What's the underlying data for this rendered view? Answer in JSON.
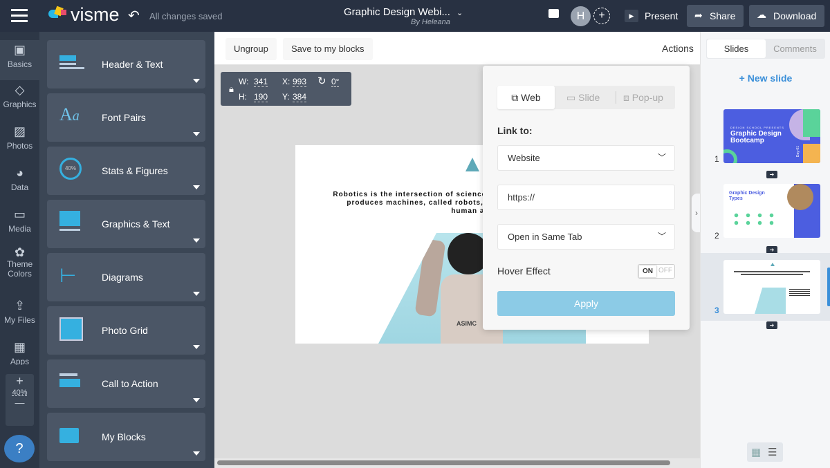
{
  "topbar": {
    "brand": "visme",
    "save_status": "All changes saved",
    "doc_title": "Graphic Design Webi...",
    "doc_author": "By Heleana",
    "avatar_initial": "H",
    "present": "Present",
    "share": "Share",
    "download": "Download"
  },
  "rail": [
    {
      "label": "Basics",
      "icon": "abc-blocks-icon"
    },
    {
      "label": "Graphics",
      "icon": "shapes-icon"
    },
    {
      "label": "Photos",
      "icon": "photo-icon"
    },
    {
      "label": "Data",
      "icon": "pie-chart-icon"
    },
    {
      "label": "Media",
      "icon": "media-icon"
    },
    {
      "label": "Theme Colors",
      "icon": "palette-icon"
    },
    {
      "label": "My Files",
      "icon": "upload-icon"
    },
    {
      "label": "Apps",
      "icon": "apps-grid-icon"
    }
  ],
  "zoom": {
    "plus": "+",
    "value": "40%",
    "minus": "—"
  },
  "help": "?",
  "blocks": [
    {
      "label": "Header & Text"
    },
    {
      "label": "Font Pairs"
    },
    {
      "label": "Stats & Figures",
      "badge": "40%"
    },
    {
      "label": "Graphics & Text"
    },
    {
      "label": "Diagrams"
    },
    {
      "label": "Photo Grid"
    },
    {
      "label": "Call to Action"
    },
    {
      "label": "My Blocks"
    }
  ],
  "toolbar": {
    "ungroup": "Ungroup",
    "save_blocks": "Save to my blocks",
    "actions": "Actions"
  },
  "dims": {
    "w_label": "W:",
    "w": "341",
    "h_label": "H:",
    "h": "190",
    "x_label": "X:",
    "x": "993",
    "y_label": "Y:",
    "y": "384",
    "rotation": "0°"
  },
  "slide": {
    "text1": "Robotics is the intersection of science,",
    "text2": "produces machines, called robots, t",
    "text3": "human ac",
    "robot_label": "ASIMC"
  },
  "popup": {
    "tabs": [
      {
        "label": "Web"
      },
      {
        "label": "Slide"
      },
      {
        "label": "Pop-up"
      }
    ],
    "link_to": "Link to:",
    "link_type": "Website",
    "url_placeholder": "https://",
    "open_mode": "Open in Same Tab",
    "hover_label": "Hover Effect",
    "toggle_on": "ON",
    "toggle_off": "OFF",
    "apply": "Apply"
  },
  "right": {
    "tab_slides": "Slides",
    "tab_comments": "Comments",
    "new_slide": "+ New slide",
    "slides": [
      {
        "num": "1",
        "kicker": "DESIGN SCHOOL PRESENTS",
        "title": "Graphic Design Bootcamp",
        "tag": "Day-01"
      },
      {
        "num": "2",
        "title": "Graphic Design Types"
      },
      {
        "num": "3"
      }
    ]
  },
  "colors": {
    "accent": "#3a8fd9",
    "apply": "#8ccbe6",
    "topbar": "#283142",
    "slide1": "#4c5ee0"
  }
}
